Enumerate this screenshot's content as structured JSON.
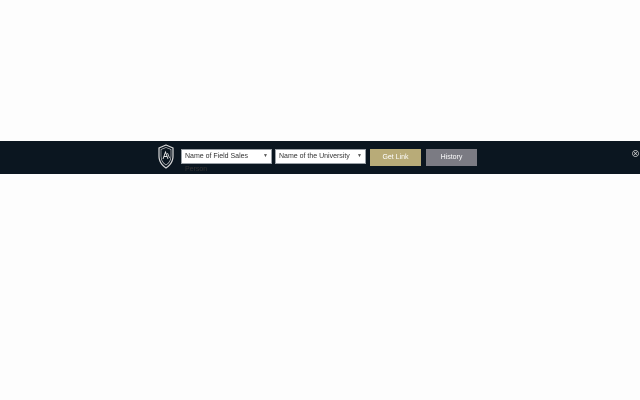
{
  "toolbar": {
    "logo_icon": "university-crest-icon",
    "sales_select": {
      "value": "Name of Field Sales Person",
      "icon": "chevron-down-icon"
    },
    "university_select": {
      "value": "Name of the University",
      "icon": "chevron-down-icon"
    },
    "get_link_label": "Get Link",
    "history_label": "History",
    "close_icon": "close-icon"
  },
  "colors": {
    "page_background": "#fdfdfd",
    "toolbar_background": "#0b1620",
    "get_link_button": "#b8ab78",
    "history_button": "#7b7b83"
  }
}
